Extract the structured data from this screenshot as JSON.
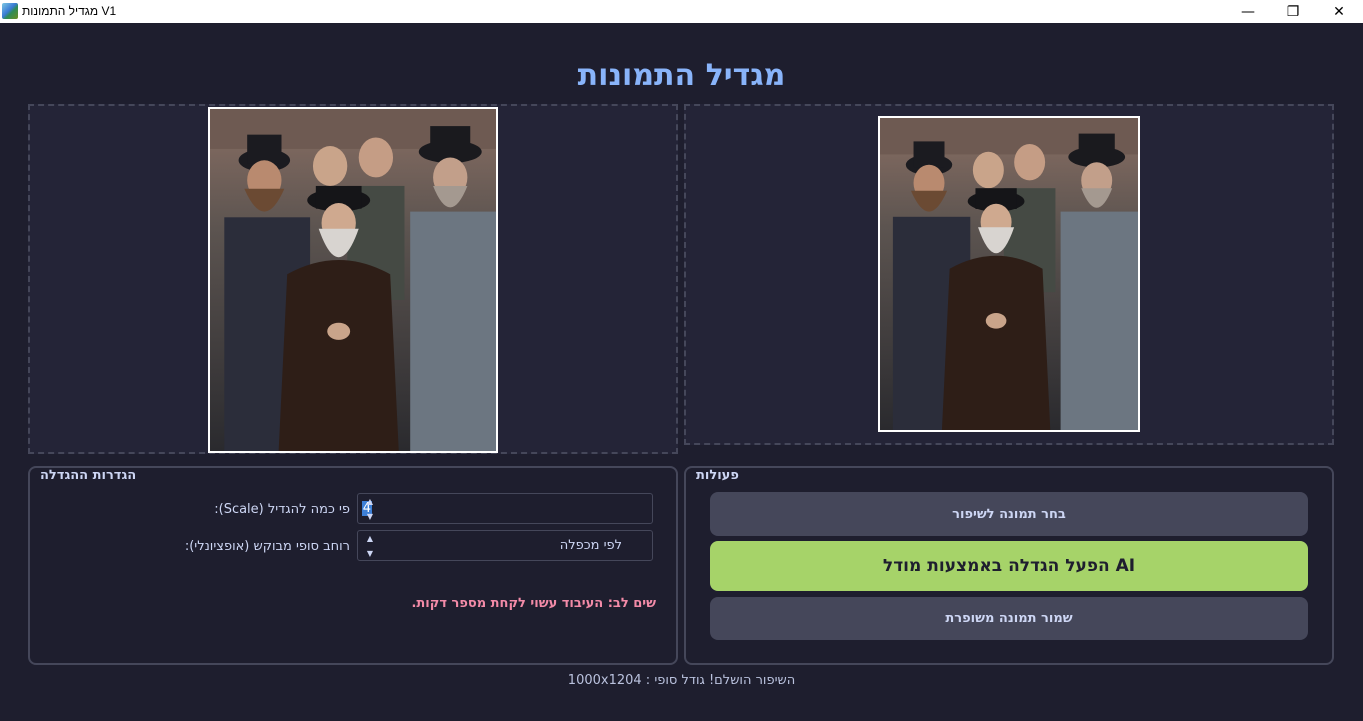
{
  "window": {
    "title": "V1 מגדיל התמונות",
    "minimize": "—",
    "maximize": "❐",
    "close": "✕"
  },
  "page_title": "מגדיל התמונות",
  "settings": {
    "group_title": "הגדרות ההגדלה",
    "scale_label": "פי כמה להגדיל (Scale):",
    "scale_value": "4",
    "width_label": "רוחב סופי מבוקש (אופציונלי):",
    "width_value": "לפי מכפלה",
    "warning": "שים לב: העיבוד  עשוי לקחת מספר דקות."
  },
  "actions": {
    "group_title": "פעולות",
    "select_button": "בחר תמונה לשיפור",
    "upscale_button": "AI הפעל הגדלה באמצעות מודל",
    "save_button": "שמור תמונה משופרת"
  },
  "status": "השיפור הושלם! גודל סופי : 1000x1204",
  "icons": {
    "app": "app-icon",
    "spin_up": "▲",
    "spin_down": "▼"
  },
  "colors": {
    "background": "#1e1e2e",
    "accent_title": "#89b4fa",
    "upscale_button": "#a6d369",
    "warning": "#f38ba8",
    "button": "#45475a"
  }
}
